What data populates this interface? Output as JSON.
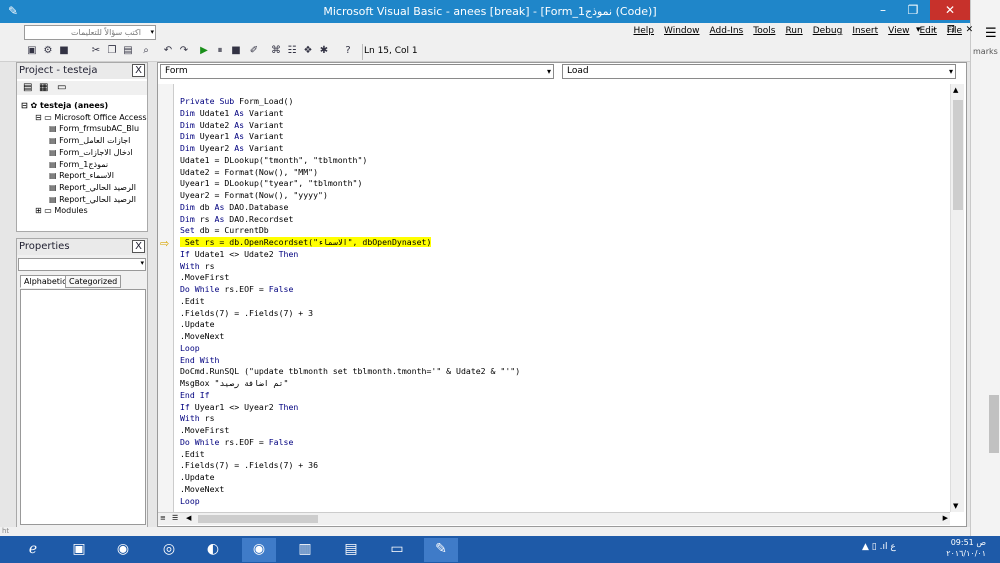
{
  "window": {
    "title": "Microsoft Visual Basic - anees [break] - [Form_نموذج1 (Code)]",
    "min": "–",
    "max": "❐",
    "close": "✕"
  },
  "ask_box": {
    "placeholder": "اكتب سؤالاً للتعليمات"
  },
  "menus": [
    "Help",
    "Window",
    "Add-Ins",
    "Tools",
    "Run",
    "Debug",
    "Insert",
    "View",
    "Edit",
    "File"
  ],
  "mdi_controls": "▾ – ❐ ✕",
  "status": {
    "position": "Ln 15, Col 1"
  },
  "project": {
    "title": "Project - testeja",
    "close": "X",
    "tree": [
      {
        "text": "testeja (anees)",
        "level": 0,
        "bold": true
      },
      {
        "text": "Microsoft Office Access C",
        "level": 1
      },
      {
        "text": "Form_frmsubAC_Blu",
        "level": 2
      },
      {
        "text": "Form_اجازات العامل",
        "level": 2
      },
      {
        "text": "Form_ادخال الاجازات",
        "level": 2
      },
      {
        "text": "Form_نموذج1",
        "level": 2
      },
      {
        "text": "Report_الاسماء",
        "level": 2
      },
      {
        "text": "Report_الرصيد الحالي",
        "level": 2
      },
      {
        "text": "Report_الرصيد الحالي",
        "level": 2
      },
      {
        "text": "Modules",
        "level": 1
      }
    ]
  },
  "properties": {
    "title": "Properties",
    "close": "X",
    "tabs": [
      "Alphabetic",
      "Categorized"
    ]
  },
  "code_window": {
    "object_combo": "Form",
    "proc_combo": "Load"
  },
  "code_lines": [
    "Private Sub Form_Load()",
    "Dim Udate1 As Variant",
    "Dim Udate2 As Variant",
    "Dim Uyear1 As Variant",
    "Dim Uyear2 As Variant",
    "Udate1 = DLookup(\"tmonth\", \"tblmonth\")",
    "Udate2 = Format(Now(), \"MM\")",
    "Uyear1 = DLookup(\"tyear\", \"tblmonth\")",
    "Uyear2 = Format(Now(), \"yyyy\")",
    "Dim db As DAO.Database",
    "Dim rs As DAO.Recordset",
    "Set db = CurrentDb",
    " Set rs = db.OpenRecordset(\"الاسماء\", dbOpenDynaset)",
    "If Udate1 <> Udate2 Then",
    "With rs",
    ".MoveFirst",
    "Do While rs.EOF = False",
    ".Edit",
    ".Fields(7) = .Fields(7) + 3",
    ".Update",
    ".MoveNext",
    "Loop",
    "End With",
    "DoCmd.RunSQL (\"update tblmonth set tblmonth.tmonth='\" & Udate2 & \"'\")",
    "MsgBox \"تم اضافة رصيد\"",
    "End If",
    "If Uyear1 <> Uyear2 Then",
    "With rs",
    ".MoveFirst",
    "Do While rs.EOF = False",
    ".Edit",
    ".Fields(7) = .Fields(7) + 36",
    ".Update",
    ".MoveNext",
    "Loop"
  ],
  "highlight_line": 12,
  "browser_strip": {
    "label": "marks"
  },
  "taskbar": {
    "clock_time": "09:51 ص",
    "clock_date": "٢٠١٦/١٠/٠١",
    "tray": "▲  ▯ .ıl  ع"
  },
  "status_left": "ht"
}
